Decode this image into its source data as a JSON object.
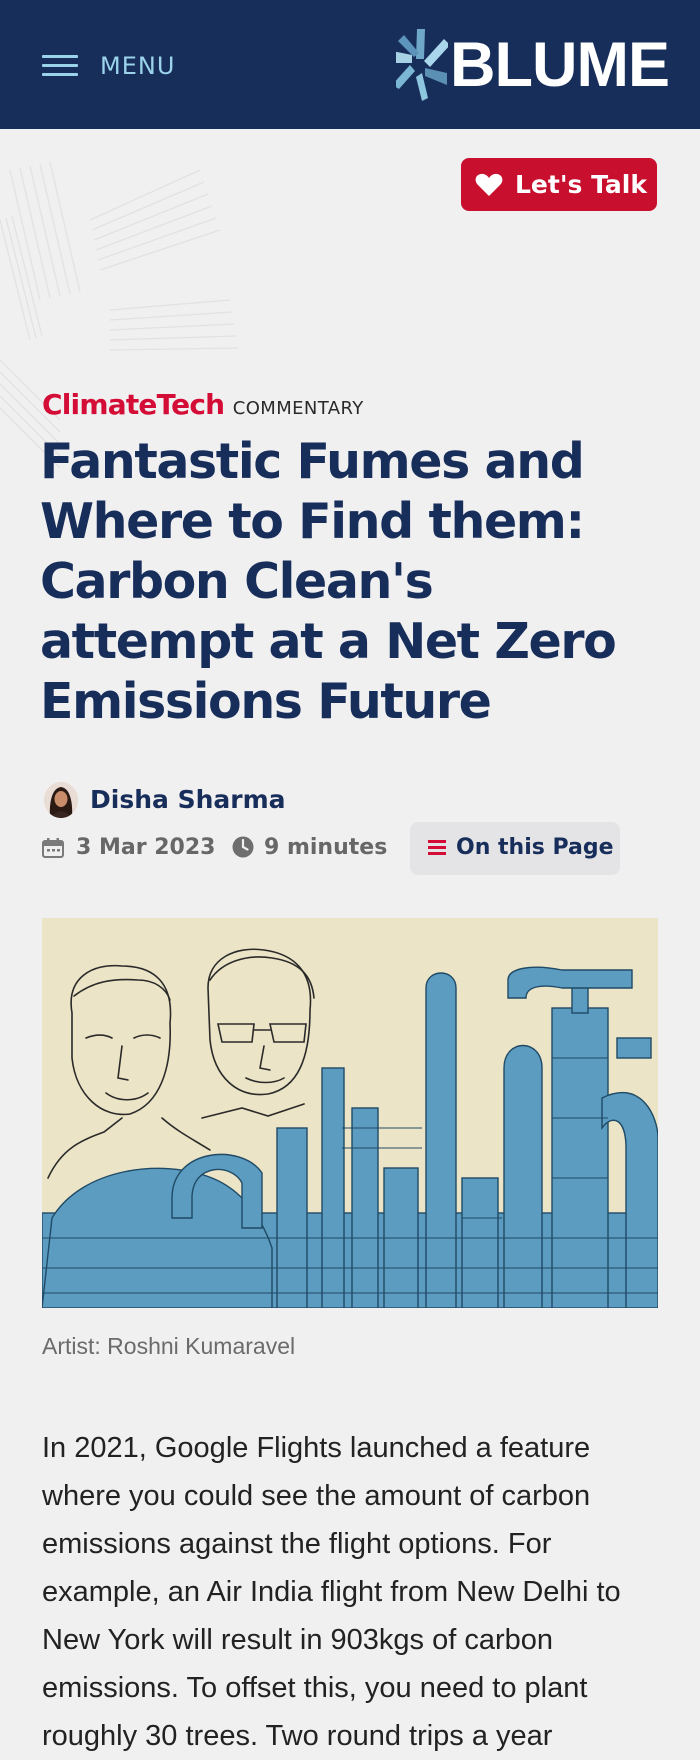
{
  "header": {
    "menu_label": "MENU",
    "logo_text": "BLUME"
  },
  "cta": {
    "lets_talk_label": "Let's Talk"
  },
  "article": {
    "category": "ClimateTech",
    "type": "COMMENTARY",
    "title": "Fantastic Fumes and Where to Find them: Carbon Clean's attempt at a Net Zero Emissions Future",
    "author": "Disha Sharma",
    "date": "3 Mar 2023",
    "read_time": "9 minutes",
    "toc_label": "On this Page",
    "image_caption": "Artist: Roshni Kumaravel",
    "body_paragraph": "In 2021, Google Flights launched a feature where you could see the amount of carbon emissions against the flight options. For example, an Air India flight from New Delhi to New York will result in 903kgs of carbon emissions. To offset this, you need to plant roughly 30 trees. Two round trips a year"
  },
  "colors": {
    "header_bg": "#172d5a",
    "accent_red": "#c8102e",
    "category_red": "#d40d36",
    "menu_blue": "#9bd3ea",
    "page_bg": "#f1f0f1",
    "illustration_bg": "#ece4c6",
    "illustration_blue": "#5b9cc0"
  },
  "icons": [
    "hamburger-icon",
    "blume-logo-mark",
    "heart-icon",
    "calendar-icon",
    "clock-icon",
    "list-icon"
  ]
}
